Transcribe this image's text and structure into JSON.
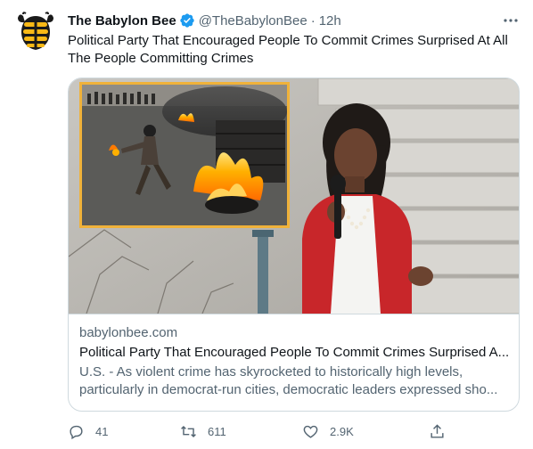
{
  "author": {
    "display_name": "The Babylon Bee",
    "handle": "@TheBabylonBee",
    "separator": "·",
    "time": "12h",
    "verified": true
  },
  "tweet": {
    "text": "Political Party That Encouraged People To Commit Crimes Surprised At All The People Committing Crimes"
  },
  "card": {
    "domain": "babylonbee.com",
    "title": "Political Party That Encouraged People To Commit Crimes Surprised A...",
    "description": "U.S. - As violent crime has skyrocketed to historically high levels, particularly in democrat-run cities, democratic leaders expressed sho..."
  },
  "actions": {
    "replies": "41",
    "retweets": "611",
    "likes": "2.9K"
  },
  "icons": {
    "avatar": "bee-logo-icon",
    "verified": "verified-badge-icon",
    "more": "more-dots-icon",
    "reply": "reply-icon",
    "retweet": "retweet-icon",
    "like": "heart-icon",
    "share": "share-icon"
  },
  "colors": {
    "text": "#0f1419",
    "secondary": "#536471",
    "verified": "#1d9bf0",
    "retweet_accent": "#00ba7c",
    "border": "#cfd9de",
    "avatar_yellow": "#f9b916"
  }
}
